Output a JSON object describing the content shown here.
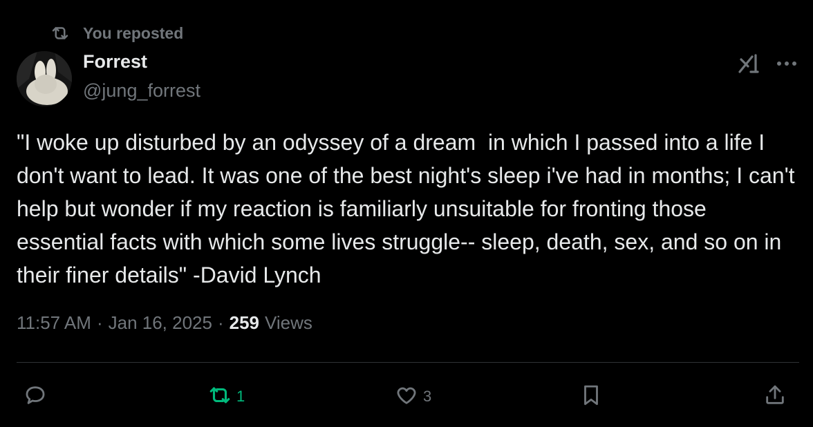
{
  "repost_label": "You reposted",
  "author": {
    "name": "Forrest",
    "handle": "@jung_forrest"
  },
  "tweet_text": "\"I woke up disturbed by an odyssey of a dream  in which I passed into a life I don't want to lead. It was one of the best night's sleep i've had in months; I can't help but wonder if my reaction is familiarly unsuitable for fronting those essential facts with which some lives struggle-- sleep, death, sex, and so on in their finer details\" -David Lynch",
  "meta": {
    "time": "11:57 AM",
    "separator": "·",
    "date": "Jan 16, 2025",
    "views_count": "259",
    "views_label": "Views"
  },
  "actions": {
    "reply_icon": "reply-icon",
    "repost_icon": "repost-icon",
    "repost_count": "1",
    "like_icon": "heart-icon",
    "like_count": "3",
    "bookmark_icon": "bookmark-icon",
    "share_icon": "share-icon"
  },
  "colors": {
    "background": "#000000",
    "text": "#e7e9ea",
    "muted": "#71767b",
    "divider": "#2f3336",
    "repost_active": "#00ba7c"
  }
}
